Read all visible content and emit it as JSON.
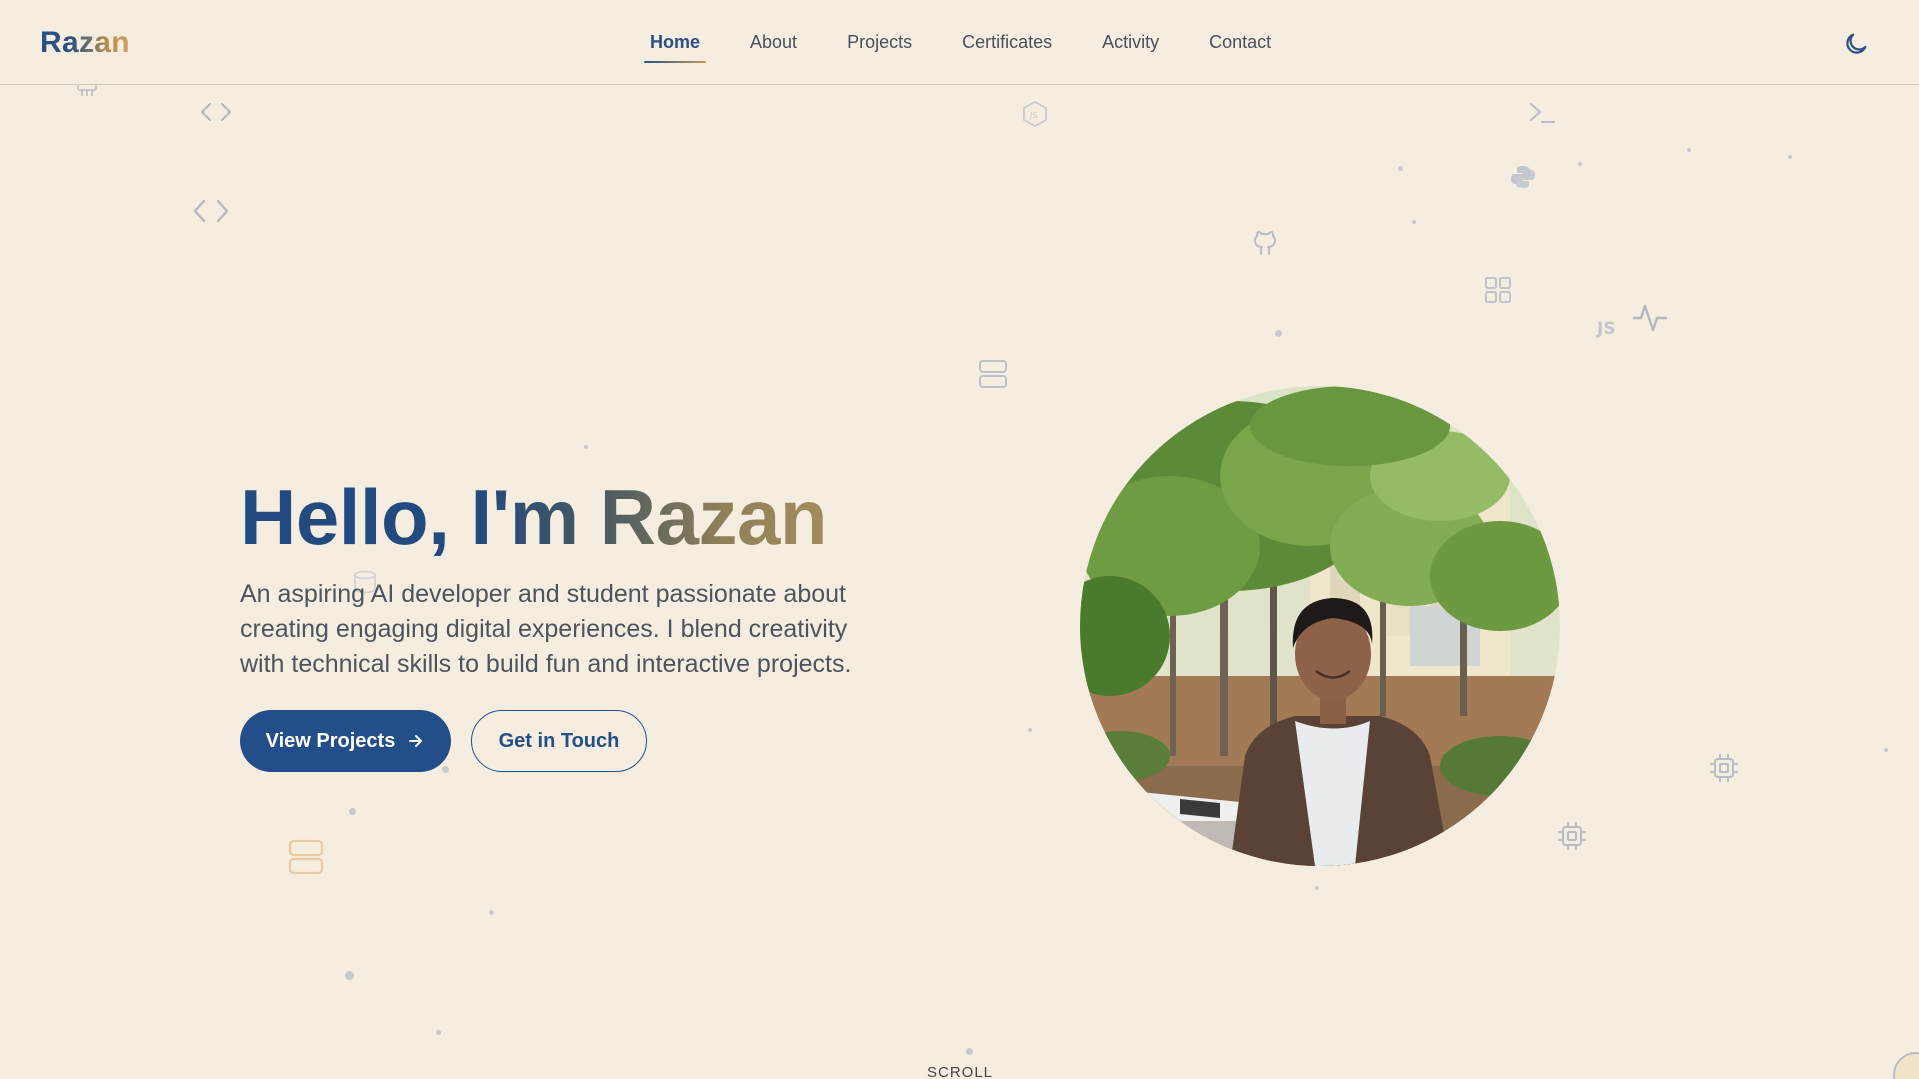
{
  "brand": {
    "logo_text": "Razan"
  },
  "nav": {
    "items": [
      {
        "label": "Home",
        "active": true
      },
      {
        "label": "About",
        "active": false
      },
      {
        "label": "Projects",
        "active": false
      },
      {
        "label": "Certificates",
        "active": false
      },
      {
        "label": "Activity",
        "active": false
      },
      {
        "label": "Contact",
        "active": false
      }
    ],
    "theme_toggle_icon": "moon-icon"
  },
  "hero": {
    "title": "Hello, I'm Razan",
    "description": "An aspiring AI developer and student passionate about creating engaging digital experiences. I blend creativity with technical skills to build fun and interactive projects.",
    "primary_button": "View Projects",
    "primary_button_icon": "arrow-right-icon",
    "secondary_button": "Get in Touch",
    "photo_icon": "profile-photo"
  },
  "scroll_hint": "SCROLL",
  "colors": {
    "background": "#f5eee0",
    "primary": "#234e8a",
    "accent": "#c79a5a",
    "text": "#4f535b"
  }
}
